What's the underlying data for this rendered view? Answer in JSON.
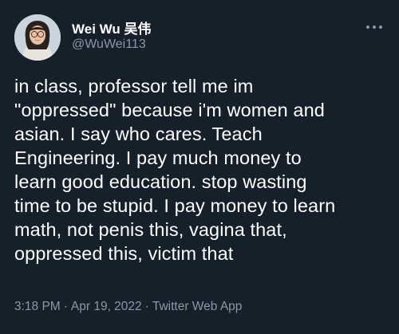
{
  "author": {
    "display_name": "Wei Wu 吴伟",
    "handle": "@WuWei113"
  },
  "tweet": {
    "lines": [
      "in class, professor tell me im",
      "\"oppressed\" because i'm women and",
      "asian. I say who cares. Teach",
      "Engineering. I pay much money to",
      "learn good education. stop wasting",
      "time to be stupid. I pay money to learn",
      "math, not penis this, vagina that,",
      "oppressed this, victim that"
    ]
  },
  "meta": {
    "time": "3:18 PM",
    "separator": "·",
    "date": "Apr 19, 2022",
    "source": "Twitter Web App"
  },
  "colors": {
    "background": "#15202b",
    "text": "#ffffff",
    "secondary": "#8b98a5"
  },
  "icons": {
    "more": "more-horizontal-icon"
  }
}
